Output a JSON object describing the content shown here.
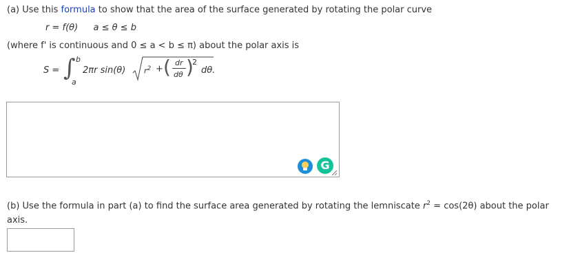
{
  "part_a": {
    "intro_prefix": "(a) Use this ",
    "intro_link": "formula",
    "intro_suffix": " to show that the area of the surface generated by rotating the polar curve",
    "curve_eq": "r = f(θ)",
    "curve_range": "a ≤ θ ≤ b",
    "condition": "(where f' is continuous and 0 ≤ a < b ≤ π) about the polar axis is",
    "formula": {
      "lhs": "S =",
      "integral_sign": "∫",
      "upper_limit": "b",
      "lower_limit": "a",
      "integrand": "2πr sin(θ)",
      "r_sq": "r",
      "r_sq_exp": "2",
      "plus": "+",
      "frac_num": "dr",
      "frac_den": "dθ",
      "paren_exp": "2",
      "dtheta": "dθ."
    }
  },
  "part_b": {
    "prompt_line1": "(b) Use the formula in part (a) to find the surface area generated by rotating the lemniscate ",
    "lemniscate_r": "r",
    "lemniscate_exp": "2",
    "lemniscate_rest": " = cos(2θ)  about the polar",
    "prompt_line2": "axis."
  },
  "widgets": {
    "grammarly_letter": "G"
  }
}
